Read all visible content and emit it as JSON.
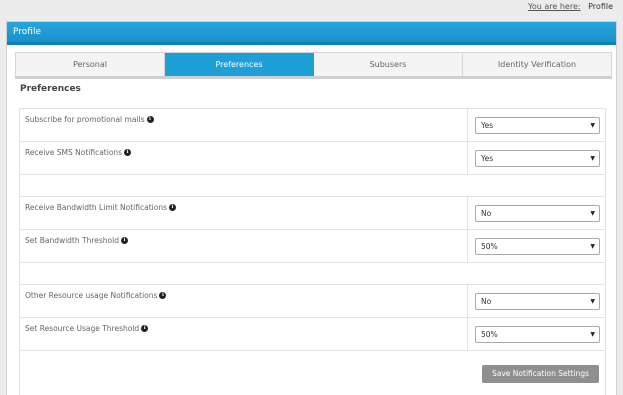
{
  "breadcrumb": {
    "prefix": "You are here:",
    "current": "Profile"
  },
  "panel": {
    "title": "Profile"
  },
  "tabs": [
    {
      "label": "Personal",
      "active": false
    },
    {
      "label": "Preferences",
      "active": true
    },
    {
      "label": "Subusers",
      "active": false
    },
    {
      "label": "Identity Verification",
      "active": false
    }
  ],
  "section": {
    "title": "Preferences"
  },
  "settings": {
    "promo": {
      "label": "Subscribe for promotional mails",
      "value": "Yes"
    },
    "sms": {
      "label": "Receive SMS Notifications",
      "value": "Yes"
    },
    "bandwidth_notify": {
      "label": "Receive Bandwidth Limit Notifications",
      "value": "No"
    },
    "bandwidth_threshold": {
      "label": "Set Bandwidth Threshold",
      "value": "50%"
    },
    "resource_notify": {
      "label": "Other Resource usage Notifications",
      "value": "No"
    },
    "resource_threshold": {
      "label": "Set Resource Usage Threshold",
      "value": "50%"
    }
  },
  "icons": {
    "info": "info-icon",
    "caret": "caret-down-icon"
  },
  "actions": {
    "save_label": "Save Notification Settings"
  },
  "colors": {
    "accent": "#1f9fd7",
    "button": "#8f8f8f"
  }
}
